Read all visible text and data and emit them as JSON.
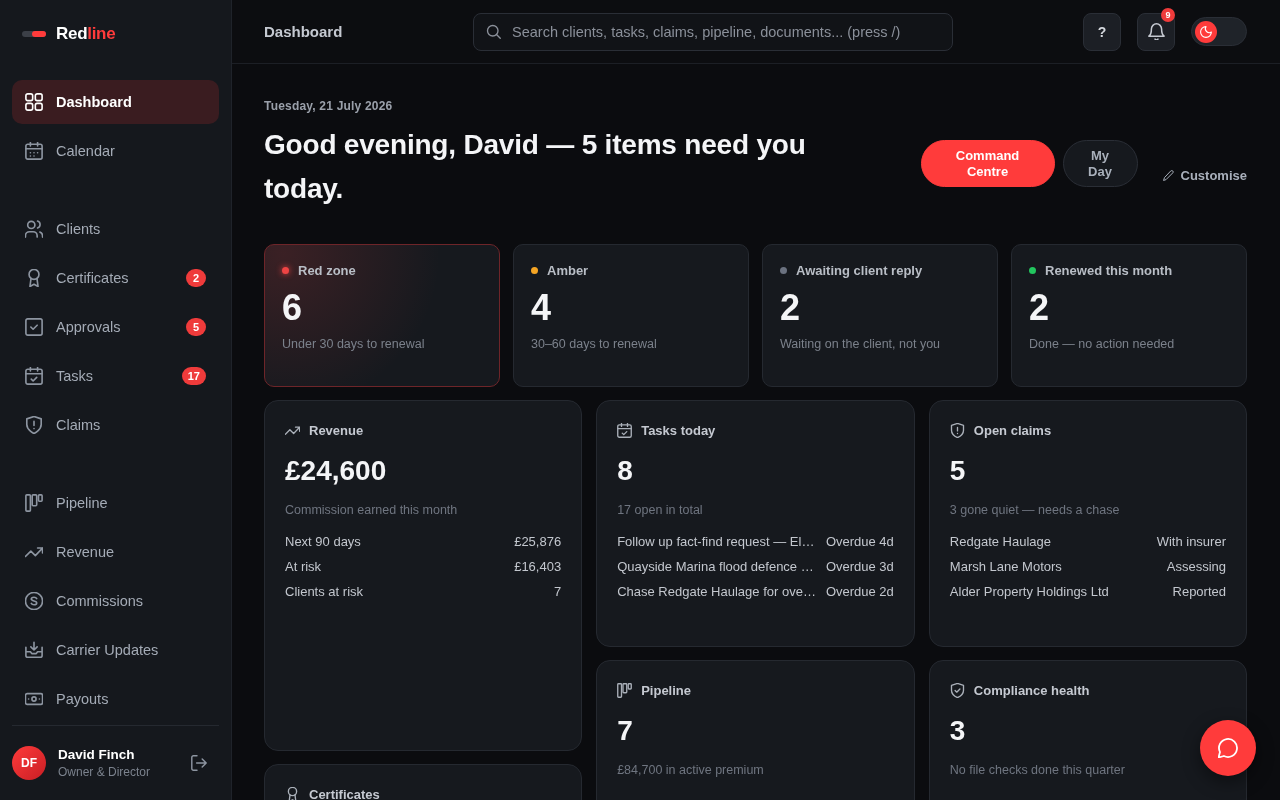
{
  "sidebar": {
    "logo": {
      "parts": [
        {
          "text": "Red",
          "accent": false
        },
        {
          "text": "line",
          "accent": true
        }
      ]
    },
    "groups": [
      {
        "items": [
          {
            "label": "Dashboard",
            "selected": true
          },
          {
            "label": "Calendar",
            "selected": false
          }
        ]
      },
      {
        "items": [
          {
            "label": "Clients",
            "selected": false
          },
          {
            "label": "Certificates",
            "selected": false,
            "badge": "2"
          },
          {
            "label": "Approvals",
            "selected": false,
            "badge": "5"
          },
          {
            "label": "Tasks",
            "selected": false,
            "badge": "17"
          },
          {
            "label": "Claims",
            "selected": false
          }
        ]
      },
      {
        "items": [
          {
            "label": "Pipeline",
            "selected": false
          },
          {
            "label": "Revenue",
            "selected": false
          },
          {
            "label": "Commissions",
            "selected": false
          },
          {
            "label": "Carrier Updates",
            "selected": false
          },
          {
            "label": "Payouts",
            "selected": false
          }
        ]
      }
    ],
    "user": {
      "initials": "DF",
      "name": "David Finch",
      "role": "Owner & Director"
    }
  },
  "header": {
    "title": "Dashboard",
    "search": {
      "placeholder": "Search clients, tasks, claims, pipeline, documents... (press /)"
    },
    "help_button": "?",
    "notifications": {
      "badge": "9"
    },
    "theme_toggle": {
      "dark": true
    }
  },
  "greeting": {
    "date": "Tuesday, 21 July 2026",
    "title": "Good evening, David — 5 items need you today.",
    "views": [
      {
        "label": "Command Centre",
        "selected": true
      },
      {
        "label": "My Day",
        "selected": false
      }
    ],
    "customise": "Customise"
  },
  "stats": [
    {
      "label": "Red zone",
      "value": "6",
      "caption": "Under 30 days to renewal",
      "color": "#ef4444",
      "highlighted": true
    },
    {
      "label": "Amber",
      "value": "4",
      "caption": "30–60 days to renewal",
      "color": "#f5a524",
      "highlighted": false
    },
    {
      "label": "Awaiting client reply",
      "value": "2",
      "caption": "Waiting on the client, not you",
      "color": "#6b7280",
      "highlighted": false
    },
    {
      "label": "Renewed this month",
      "value": "2",
      "caption": "Done — no action needed",
      "color": "#22c55e",
      "highlighted": false
    }
  ],
  "columns": [
    {
      "panels": [
        {
          "title": "Revenue",
          "value": "£24,600",
          "caption": "Commission earned this month",
          "rows": [
            {
              "label": "Next 90 days",
              "value": "£25,876"
            },
            {
              "label": "At risk",
              "value": "£16,403"
            },
            {
              "label": "Clients at risk",
              "value": "7"
            }
          ]
        },
        {
          "title": "Certificates"
        }
      ]
    },
    {
      "panels": [
        {
          "title": "Tasks today",
          "value": "8",
          "caption": "17 open in total",
          "rows": [
            {
              "label": "Follow up fact-find request — El…",
              "value": "Overdue 4d"
            },
            {
              "label": "Quayside Marina flood defence …",
              "value": "Overdue 3d"
            },
            {
              "label": "Chase Redgate Haulage for ove…",
              "value": "Overdue 2d"
            }
          ]
        },
        {
          "title": "Pipeline",
          "value": "7",
          "caption": "£84,700 in active premium"
        }
      ]
    },
    {
      "panels": [
        {
          "title": "Open claims",
          "value": "5",
          "caption": "3 gone quiet — needs a chase",
          "rows": [
            {
              "label": "Redgate Haulage",
              "value": "With insurer"
            },
            {
              "label": "Marsh Lane Motors",
              "value": "Assessing"
            },
            {
              "label": "Alder Property Holdings Ltd",
              "value": "Reported"
            }
          ]
        },
        {
          "title": "Compliance health",
          "value": "3",
          "caption": "No file checks done this quarter"
        }
      ]
    }
  ]
}
